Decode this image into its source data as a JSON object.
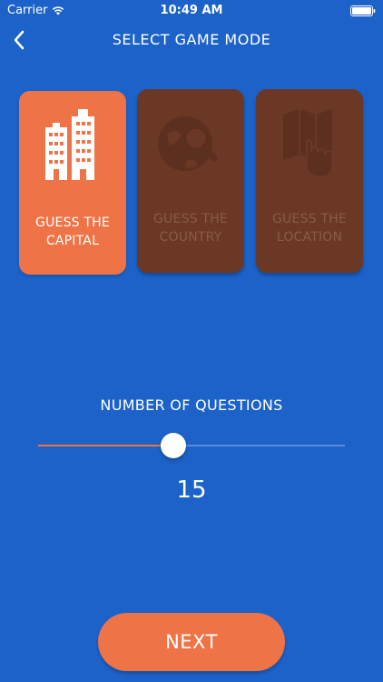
{
  "status_bar": {
    "carrier": "Carrier",
    "time": "10:49 AM",
    "wifi_icon": "wifi-icon",
    "battery_icon": "battery-icon"
  },
  "nav": {
    "title": "SELECT GAME MODE",
    "back_icon": "chevron-left-icon"
  },
  "modes": [
    {
      "line1": "GUESS THE",
      "line2": "CAPITAL",
      "icon": "buildings-icon",
      "selected": true
    },
    {
      "line1": "GUESS THE",
      "line2": "COUNTRY",
      "icon": "globe-search-icon",
      "selected": false
    },
    {
      "line1": "GUESS THE",
      "line2": "LOCATION",
      "icon": "map-touch-icon",
      "selected": false
    }
  ],
  "questions": {
    "label": "NUMBER OF QUESTIONS",
    "value": "15",
    "slider_fraction": 0.44
  },
  "next_button": {
    "label": "NEXT"
  },
  "colors": {
    "background": "#1C62C9",
    "accent": "#EE7447",
    "disabled_card": "#6B3825",
    "disabled_text": "#8A5A48",
    "track": "#5A8BD8"
  }
}
